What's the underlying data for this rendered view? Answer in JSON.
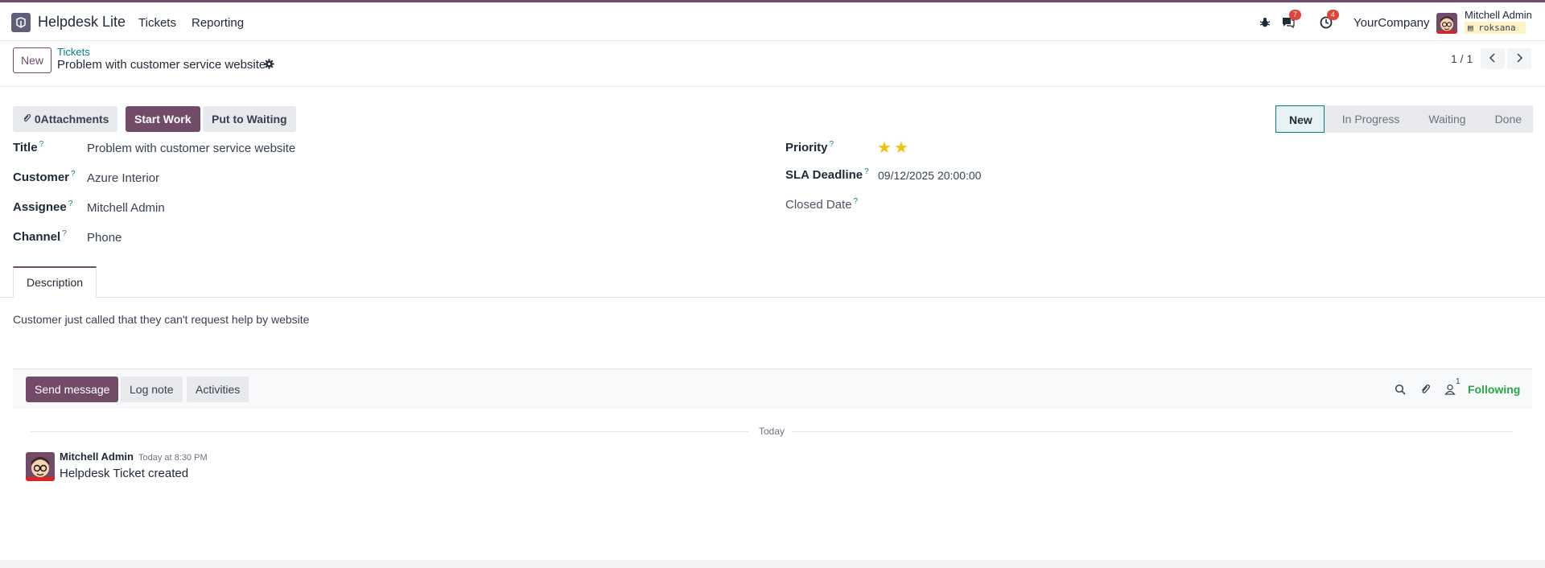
{
  "navbar": {
    "app_name": "Helpdesk Lite",
    "menu": [
      "Tickets",
      "Reporting"
    ],
    "messages_badge": "7",
    "activities_badge": "4",
    "company": "YourCompany",
    "user_name": "Mitchell Admin",
    "database": "roksana",
    "accent_color": "#714b67"
  },
  "control_panel": {
    "new_label": "New",
    "breadcrumb": "Tickets",
    "record_title": "Problem with customer service website",
    "pager": "1 / 1"
  },
  "actions": {
    "attachments": "0Attachments",
    "start_work": "Start Work",
    "put_to_waiting": "Put to Waiting"
  },
  "stages": [
    "New",
    "In Progress",
    "Waiting",
    "Done"
  ],
  "active_stage": "New",
  "fields": {
    "title_label": "Title",
    "title_value": "Problem with customer service website",
    "customer_label": "Customer",
    "customer_value": "Azure Interior",
    "assignee_label": "Assignee",
    "assignee_value": "Mitchell Admin",
    "channel_label": "Channel",
    "channel_value": "Phone",
    "priority_label": "Priority",
    "priority_stars": 2,
    "sla_label": "SLA Deadline",
    "sla_value": "09/12/2025 20:00:00",
    "closed_label": "Closed Date",
    "help_mark": "?"
  },
  "tabs": {
    "description_tab": "Description",
    "description_text": "Customer just called that they can't request help by website"
  },
  "chatter": {
    "send_message": "Send message",
    "log_note": "Log note",
    "activities": "Activities",
    "followers_count": "1",
    "following": "Following",
    "date_separator": "Today",
    "message": {
      "author": "Mitchell Admin",
      "date": "Today at 8:30 PM",
      "body": "Helpdesk Ticket created"
    }
  }
}
